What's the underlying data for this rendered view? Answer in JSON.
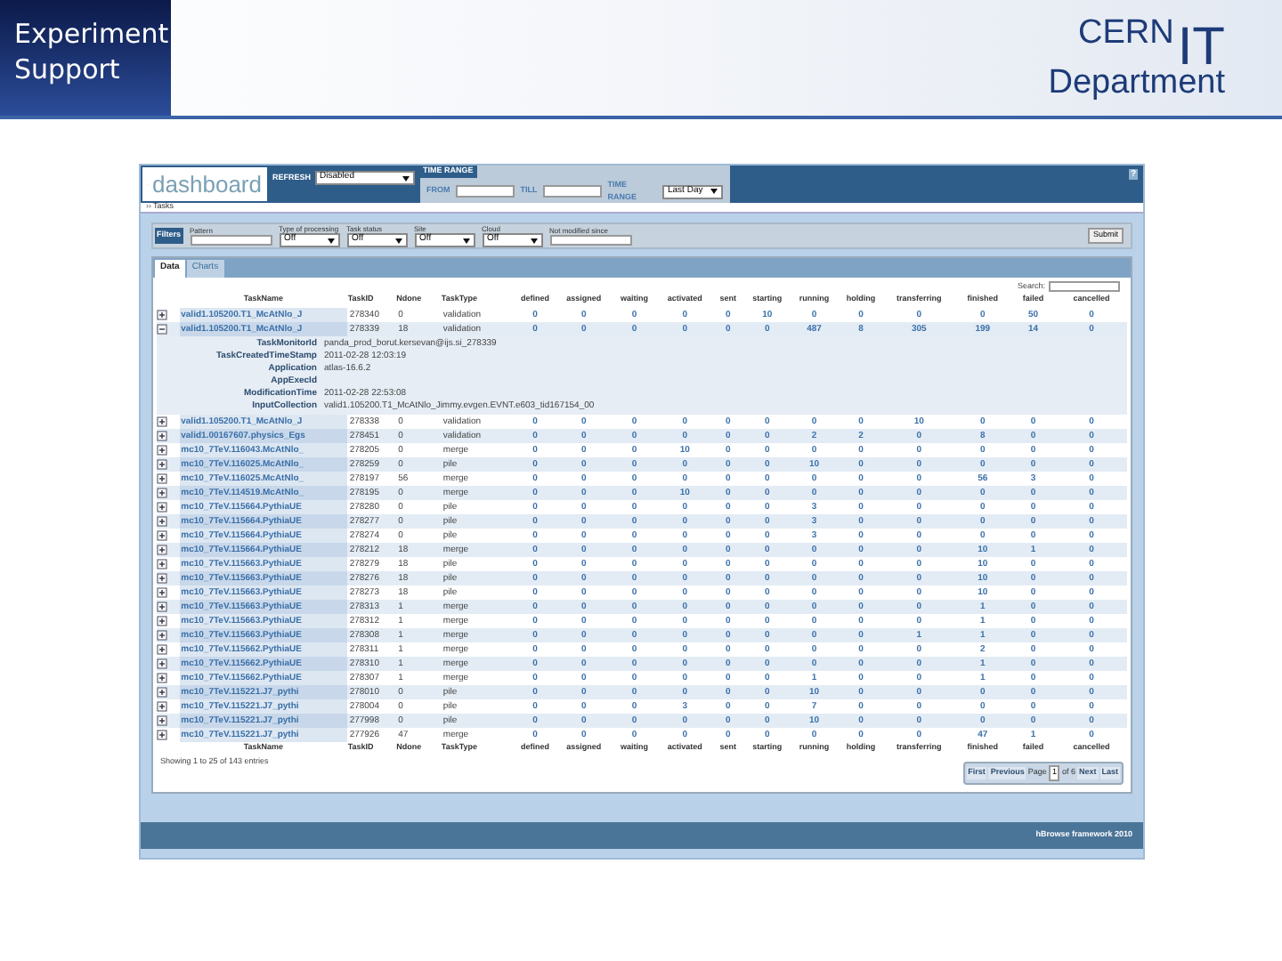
{
  "slide": {
    "title_lines": [
      "Experiment",
      "Support"
    ],
    "logo": {
      "top": "CERN",
      "big": "IT",
      "bottom": "Department"
    }
  },
  "app": {
    "logo_text": "dashboard",
    "refresh": {
      "label": "REFRESH",
      "value": "Disabled"
    },
    "time_range": {
      "title": "TIME RANGE",
      "from_label": "FROM",
      "till_label": "TILL",
      "range_label": "TIME RANGE",
      "range_value": "Last Day"
    },
    "help": "?"
  },
  "breadcrumb": {
    "arrow": "››",
    "label": "Tasks"
  },
  "filters": {
    "button": "Filters",
    "fields": [
      {
        "label": "Pattern",
        "kind": "input"
      },
      {
        "label": "Type of processing",
        "kind": "select",
        "value": "Off"
      },
      {
        "label": "Task status",
        "kind": "select",
        "value": "Off"
      },
      {
        "label": "Site",
        "kind": "select",
        "value": "Off"
      },
      {
        "label": "Cloud",
        "kind": "select",
        "value": "Off"
      },
      {
        "label": "Not modified since",
        "kind": "input"
      }
    ],
    "submit": "Submit"
  },
  "tabs": [
    {
      "label": "Data",
      "selected": true
    },
    {
      "label": "Charts",
      "selected": false
    }
  ],
  "search_label": "Search:",
  "table": {
    "columns": [
      "TaskName",
      "TaskID",
      "Ndone",
      "TaskType",
      "defined",
      "assigned",
      "waiting",
      "activated",
      "sent",
      "starting",
      "running",
      "holding",
      "transferring",
      "finished",
      "failed",
      "cancelled"
    ],
    "rows": [
      {
        "expanded": false,
        "cells": [
          "valid1.105200.T1_McAtNlo_J",
          "278340",
          "0",
          "validation",
          "0",
          "0",
          "0",
          "0",
          "0",
          "10",
          "0",
          "0",
          "0",
          "0",
          "50",
          "0"
        ]
      },
      {
        "expanded": true,
        "cells": [
          "valid1.105200.T1_McAtNlo_J",
          "278339",
          "18",
          "validation",
          "0",
          "0",
          "0",
          "0",
          "0",
          "0",
          "487",
          "8",
          "305",
          "199",
          "14",
          "0"
        ],
        "details": [
          {
            "label": "TaskMonitorId",
            "value": "panda_prod_borut.kersevan@ijs.si_278339"
          },
          {
            "label": "TaskCreatedTimeStamp",
            "value": "2011-02-28 12:03:19"
          },
          {
            "label": "Application",
            "value": "atlas-16.6.2"
          },
          {
            "label": "AppExecId"
          },
          {
            "label": "ModificationTime",
            "value": "2011-02-28 22:53:08"
          },
          {
            "label": "InputCollection",
            "value": "valid1.105200.T1_McAtNlo_Jimmy.evgen.EVNT.e603_tid167154_00"
          }
        ]
      },
      {
        "expanded": false,
        "cells": [
          "valid1.105200.T1_McAtNlo_J",
          "278338",
          "0",
          "validation",
          "0",
          "0",
          "0",
          "0",
          "0",
          "0",
          "0",
          "0",
          "10",
          "0",
          "0",
          "0"
        ]
      },
      {
        "expanded": false,
        "cells": [
          "valid1.00167607.physics_Egs",
          "278451",
          "0",
          "validation",
          "0",
          "0",
          "0",
          "0",
          "0",
          "0",
          "2",
          "2",
          "0",
          "8",
          "0",
          "0"
        ]
      },
      {
        "expanded": false,
        "cells": [
          "mc10_7TeV.116043.McAtNlo_",
          "278205",
          "0",
          "merge",
          "0",
          "0",
          "0",
          "10",
          "0",
          "0",
          "0",
          "0",
          "0",
          "0",
          "0",
          "0"
        ]
      },
      {
        "expanded": false,
        "cells": [
          "mc10_7TeV.116025.McAtNlo_",
          "278259",
          "0",
          "pile",
          "0",
          "0",
          "0",
          "0",
          "0",
          "0",
          "10",
          "0",
          "0",
          "0",
          "0",
          "0"
        ]
      },
      {
        "expanded": false,
        "cells": [
          "mc10_7TeV.116025.McAtNlo_",
          "278197",
          "56",
          "merge",
          "0",
          "0",
          "0",
          "0",
          "0",
          "0",
          "0",
          "0",
          "0",
          "56",
          "3",
          "0"
        ]
      },
      {
        "expanded": false,
        "cells": [
          "mc10_7TeV.114519.McAtNlo_",
          "278195",
          "0",
          "merge",
          "0",
          "0",
          "0",
          "10",
          "0",
          "0",
          "0",
          "0",
          "0",
          "0",
          "0",
          "0"
        ]
      },
      {
        "expanded": false,
        "cells": [
          "mc10_7TeV.115664.PythiaUE",
          "278280",
          "0",
          "pile",
          "0",
          "0",
          "0",
          "0",
          "0",
          "0",
          "3",
          "0",
          "0",
          "0",
          "0",
          "0"
        ]
      },
      {
        "expanded": false,
        "cells": [
          "mc10_7TeV.115664.PythiaUE",
          "278277",
          "0",
          "pile",
          "0",
          "0",
          "0",
          "0",
          "0",
          "0",
          "3",
          "0",
          "0",
          "0",
          "0",
          "0"
        ]
      },
      {
        "expanded": false,
        "cells": [
          "mc10_7TeV.115664.PythiaUE",
          "278274",
          "0",
          "pile",
          "0",
          "0",
          "0",
          "0",
          "0",
          "0",
          "3",
          "0",
          "0",
          "0",
          "0",
          "0"
        ]
      },
      {
        "expanded": false,
        "cells": [
          "mc10_7TeV.115664.PythiaUE",
          "278212",
          "18",
          "merge",
          "0",
          "0",
          "0",
          "0",
          "0",
          "0",
          "0",
          "0",
          "0",
          "10",
          "1",
          "0"
        ]
      },
      {
        "expanded": false,
        "cells": [
          "mc10_7TeV.115663.PythiaUE",
          "278279",
          "18",
          "pile",
          "0",
          "0",
          "0",
          "0",
          "0",
          "0",
          "0",
          "0",
          "0",
          "10",
          "0",
          "0"
        ]
      },
      {
        "expanded": false,
        "cells": [
          "mc10_7TeV.115663.PythiaUE",
          "278276",
          "18",
          "pile",
          "0",
          "0",
          "0",
          "0",
          "0",
          "0",
          "0",
          "0",
          "0",
          "10",
          "0",
          "0"
        ]
      },
      {
        "expanded": false,
        "cells": [
          "mc10_7TeV.115663.PythiaUE",
          "278273",
          "18",
          "pile",
          "0",
          "0",
          "0",
          "0",
          "0",
          "0",
          "0",
          "0",
          "0",
          "10",
          "0",
          "0"
        ]
      },
      {
        "expanded": false,
        "cells": [
          "mc10_7TeV.115663.PythiaUE",
          "278313",
          "1",
          "merge",
          "0",
          "0",
          "0",
          "0",
          "0",
          "0",
          "0",
          "0",
          "0",
          "1",
          "0",
          "0"
        ]
      },
      {
        "expanded": false,
        "cells": [
          "mc10_7TeV.115663.PythiaUE",
          "278312",
          "1",
          "merge",
          "0",
          "0",
          "0",
          "0",
          "0",
          "0",
          "0",
          "0",
          "0",
          "1",
          "0",
          "0"
        ]
      },
      {
        "expanded": false,
        "cells": [
          "mc10_7TeV.115663.PythiaUE",
          "278308",
          "1",
          "merge",
          "0",
          "0",
          "0",
          "0",
          "0",
          "0",
          "0",
          "0",
          "1",
          "1",
          "0",
          "0"
        ]
      },
      {
        "expanded": false,
        "cells": [
          "mc10_7TeV.115662.PythiaUE",
          "278311",
          "1",
          "merge",
          "0",
          "0",
          "0",
          "0",
          "0",
          "0",
          "0",
          "0",
          "0",
          "2",
          "0",
          "0"
        ]
      },
      {
        "expanded": false,
        "cells": [
          "mc10_7TeV.115662.PythiaUE",
          "278310",
          "1",
          "merge",
          "0",
          "0",
          "0",
          "0",
          "0",
          "0",
          "0",
          "0",
          "0",
          "1",
          "0",
          "0"
        ]
      },
      {
        "expanded": false,
        "cells": [
          "mc10_7TeV.115662.PythiaUE",
          "278307",
          "1",
          "merge",
          "0",
          "0",
          "0",
          "0",
          "0",
          "0",
          "1",
          "0",
          "0",
          "1",
          "0",
          "0"
        ]
      },
      {
        "expanded": false,
        "cells": [
          "mc10_7TeV.115221.J7_pythi",
          "278010",
          "0",
          "pile",
          "0",
          "0",
          "0",
          "0",
          "0",
          "0",
          "10",
          "0",
          "0",
          "0",
          "0",
          "0"
        ]
      },
      {
        "expanded": false,
        "cells": [
          "mc10_7TeV.115221.J7_pythi",
          "278004",
          "0",
          "pile",
          "0",
          "0",
          "0",
          "3",
          "0",
          "0",
          "7",
          "0",
          "0",
          "0",
          "0",
          "0"
        ]
      },
      {
        "expanded": false,
        "cells": [
          "mc10_7TeV.115221.J7_pythi",
          "277998",
          "0",
          "pile",
          "0",
          "0",
          "0",
          "0",
          "0",
          "0",
          "10",
          "0",
          "0",
          "0",
          "0",
          "0"
        ]
      },
      {
        "expanded": false,
        "cells": [
          "mc10_7TeV.115221.J7_pythi",
          "277926",
          "47",
          "merge",
          "0",
          "0",
          "0",
          "0",
          "0",
          "0",
          "0",
          "0",
          "0",
          "47",
          "1",
          "0"
        ]
      }
    ],
    "footer_columns": [
      "TaskName",
      "TaskID",
      "Ndone",
      "TaskType",
      "defined",
      "assigned",
      "waiting",
      "activated",
      "sent",
      "starting",
      "running",
      "holding",
      "transferring",
      "finished",
      "failed",
      "cancelled"
    ]
  },
  "info": "Showing 1 to 25 of 143 entries",
  "pagination": {
    "first": "First",
    "previous": "Previous",
    "page_label": "Page",
    "page": "1",
    "of": "of 6",
    "next": "Next",
    "last": "Last"
  },
  "footer": "hBrowse framework 2010"
}
